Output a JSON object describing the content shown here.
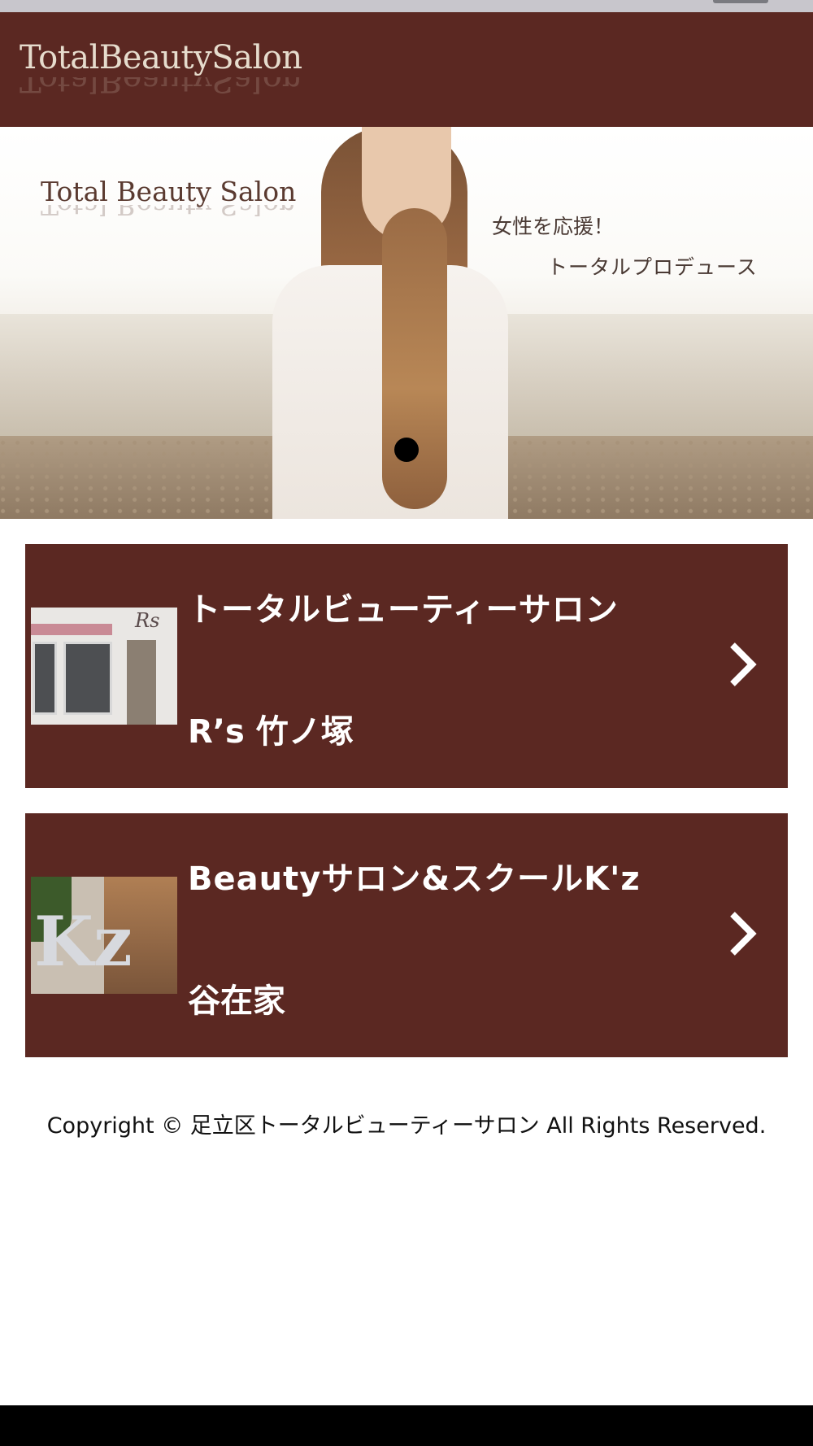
{
  "header": {
    "logo_text": "TotalBeautySalon"
  },
  "hero": {
    "title": "Total Beauty Salon",
    "tagline_1": "女性を応援！",
    "tagline_2": "トータルプロデュース"
  },
  "salons": [
    {
      "title": "トータルビューティーサロン",
      "subtitle": "R’s 竹ノ塚",
      "thumb_text": "Rs"
    },
    {
      "title": "Beautyサロン&スクールK'z",
      "subtitle": "谷在家",
      "thumb_text": "Kz"
    }
  ],
  "footer": {
    "copyright": "Copyright © 足立区トータルビューティーサロン All Rights Reserved."
  },
  "icons": {
    "card_arrow": "chevron-right-icon",
    "slider_indicator": "dot-indicator"
  },
  "colors": {
    "brand_brown": "#5b2822",
    "text_light": "#ffffff",
    "logo_cream": "#e6dccd"
  }
}
